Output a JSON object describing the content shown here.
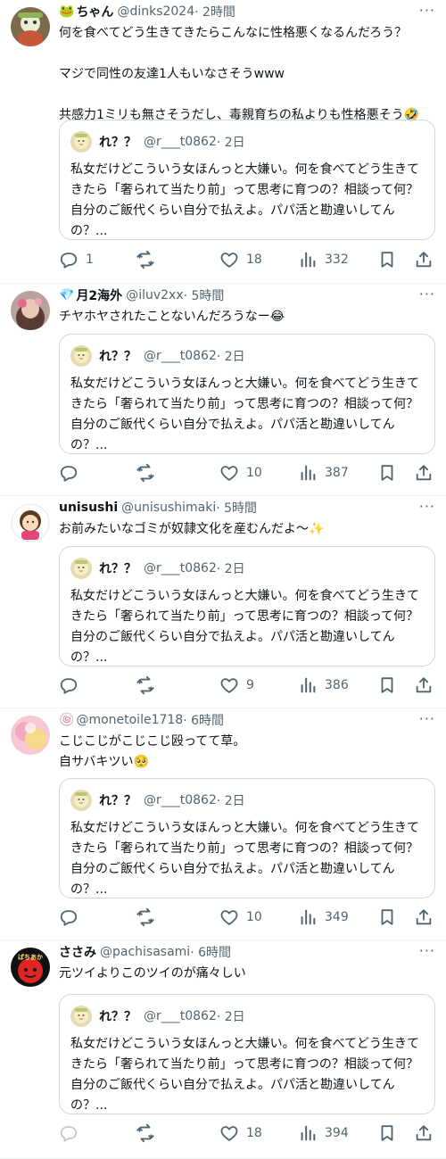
{
  "quoted": {
    "name": "れ？？",
    "handle": "@r___t0862",
    "time": "· 2日",
    "text": "私女だけどこういう女ほんっと大嫌い。何を食べてどう生きてきたら「奢られて当たり前」って思考に育つの？相談って何？自分のご飯代くらい自分で払えよ。パパ活と勘違いしてんの？..."
  },
  "posts": [
    {
      "emoji": "🐸",
      "name": "ちゃん",
      "handle": "@dinks2024",
      "time": "· 2時間",
      "text": "何を食べてどう生きてきたらこんなに性格悪くなるんだろう？\n\nマジで同性の友達1人もいなさそうwww\n\n共感力1ミリも無さそうだし、毒親育ちの私よりも性格悪そう🤣",
      "replies": "1",
      "retweets": "",
      "likes": "18",
      "views": "332"
    },
    {
      "emoji": "💎",
      "name": "月2海外",
      "handle": "@iluv2xx",
      "time": "· 5時間",
      "text": "チヤホヤされたことないんだろうなー😂",
      "replies": "",
      "retweets": "",
      "likes": "10",
      "views": "387"
    },
    {
      "emoji": "",
      "name": "unisushi",
      "handle": "@unisushimaki",
      "time": "· 5時間",
      "text": "お前みたいなゴミが奴隷文化を産むんだよ〜✨",
      "replies": "",
      "retweets": "",
      "likes": "9",
      "views": "386"
    },
    {
      "emoji": "🍥",
      "name": "",
      "handle": "@monetoile1718",
      "time": "· 6時間",
      "text": "こじこじがこじこじ殴ってて草。\n自サバキツい🥺",
      "replies": "",
      "retweets": "",
      "likes": "10",
      "views": "349"
    },
    {
      "emoji": "",
      "name": "ささみ",
      "handle": "@pachisasami",
      "time": "· 6時間",
      "text": "元ツイよりこのツイのが痛々しい",
      "replies": "",
      "retweets": "",
      "likes": "18",
      "views": "394"
    }
  ],
  "avatar_badge_text": "ぱちあか",
  "icons": [
    "more-icon",
    "reply-icon",
    "retweet-icon",
    "like-icon",
    "views-icon",
    "bookmark-icon",
    "share-icon"
  ],
  "colors": {
    "text": "#0f1419",
    "secondary": "#536471",
    "border": "#cfd9de",
    "divider": "#eff3f4"
  }
}
